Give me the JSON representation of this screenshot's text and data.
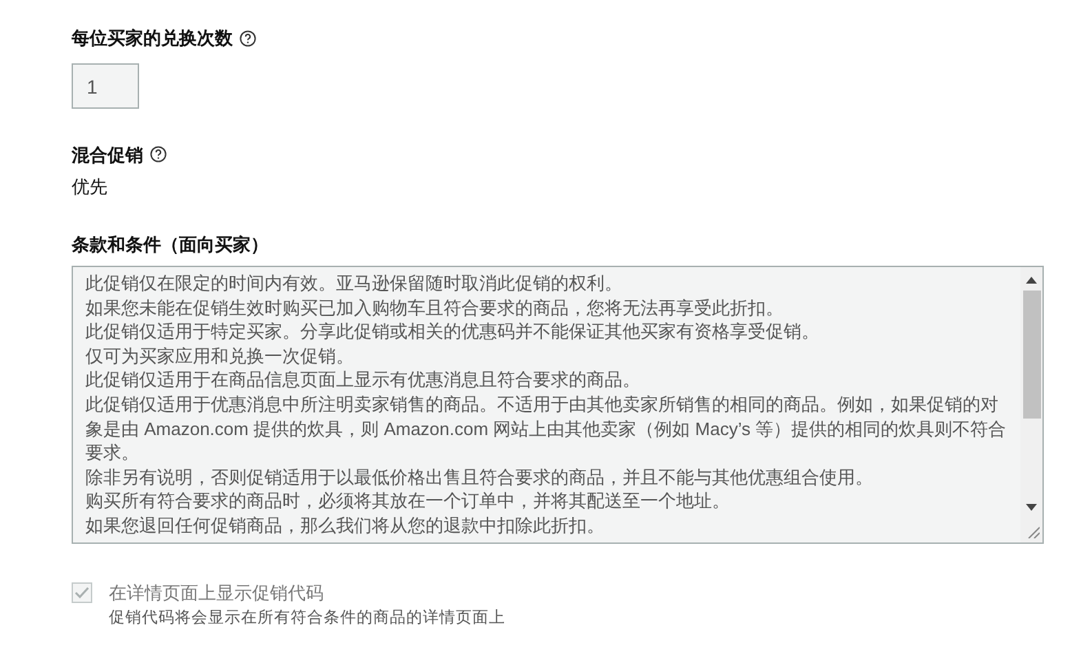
{
  "redemptions": {
    "label": "每位买家的兑换次数",
    "value": "1",
    "disabled": true
  },
  "combine": {
    "label": "混合促销",
    "value": "优先"
  },
  "terms": {
    "label": "条款和条件（面向买家）",
    "disabled": true,
    "lines": [
      "此促销仅在限定的时间内有效。亚马逊保留随时取消此促销的权利。",
      "如果您未能在促销生效时购买已加入购物车且符合要求的商品，您将无法再享受此折扣。",
      "此促销仅适用于特定买家。分享此促销或相关的优惠码并不能保证其他买家有资格享受促销。",
      "仅可为买家应用和兑换一次促销。",
      "此促销仅适用于在商品信息页面上显示有优惠消息且符合要求的商品。",
      "此促销仅适用于优惠消息中所注明卖家销售的商品。不适用于由其他卖家所销售的相同的商品。例如，如果促销的对象是由 Amazon.com 提供的炊具，则 Amazon.com 网站上由其他卖家（例如 Macy’s 等）提供的相同的炊具则不符合要求。",
      "除非另有说明，否则促销适用于以最低价格出售且符合要求的商品，并且不能与其他优惠组合使用。",
      "购买所有符合要求的商品时，必须将其放在一个订单中，并将其配送至一个地址。",
      "如果您退回任何促销商品，那么我们将从您的退款中扣除此折扣。"
    ]
  },
  "show_code": {
    "label": "在详情页面上显示促销代码",
    "description": "促销代码将会显示在所有符合条件的商品的详情页面上",
    "checked": true,
    "disabled": true
  }
}
